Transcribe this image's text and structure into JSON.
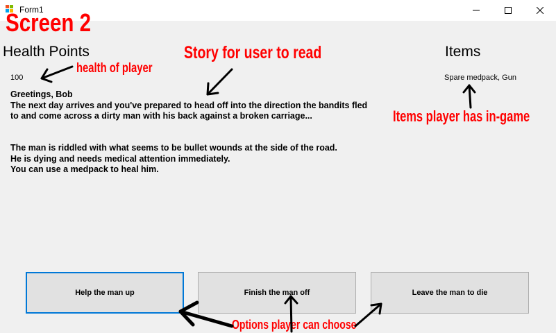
{
  "window": {
    "title": "Form1",
    "minimize_icon": "minimize-icon",
    "maximize_icon": "maximize-icon",
    "close_icon": "close-icon"
  },
  "labels": {
    "health_heading": "Health Points",
    "health_value": "100",
    "items_heading": "Items",
    "items_value": "Spare medpack, Gun"
  },
  "story": {
    "paragraph1": "Greetings, Bob\nThe next day arrives and you've prepared to head off into the direction the bandits fled\nto and come across a dirty man with his back against a broken carriage...",
    "paragraph2": "The man is riddled with what seems to be bullet wounds at the side of the road.\nHe is dying and needs medical attention immediately.\nYou can use a medpack to heal him."
  },
  "buttons": {
    "help": "Help the man up",
    "finish": "Finish the man off",
    "leave": "Leave the man to die"
  },
  "annotations": {
    "screen_title": "Screen 2",
    "health": "health of player",
    "story": "Story for user to read",
    "items": "Items player has in-game",
    "options": "Options player can choose",
    "color": "#ff0000"
  }
}
